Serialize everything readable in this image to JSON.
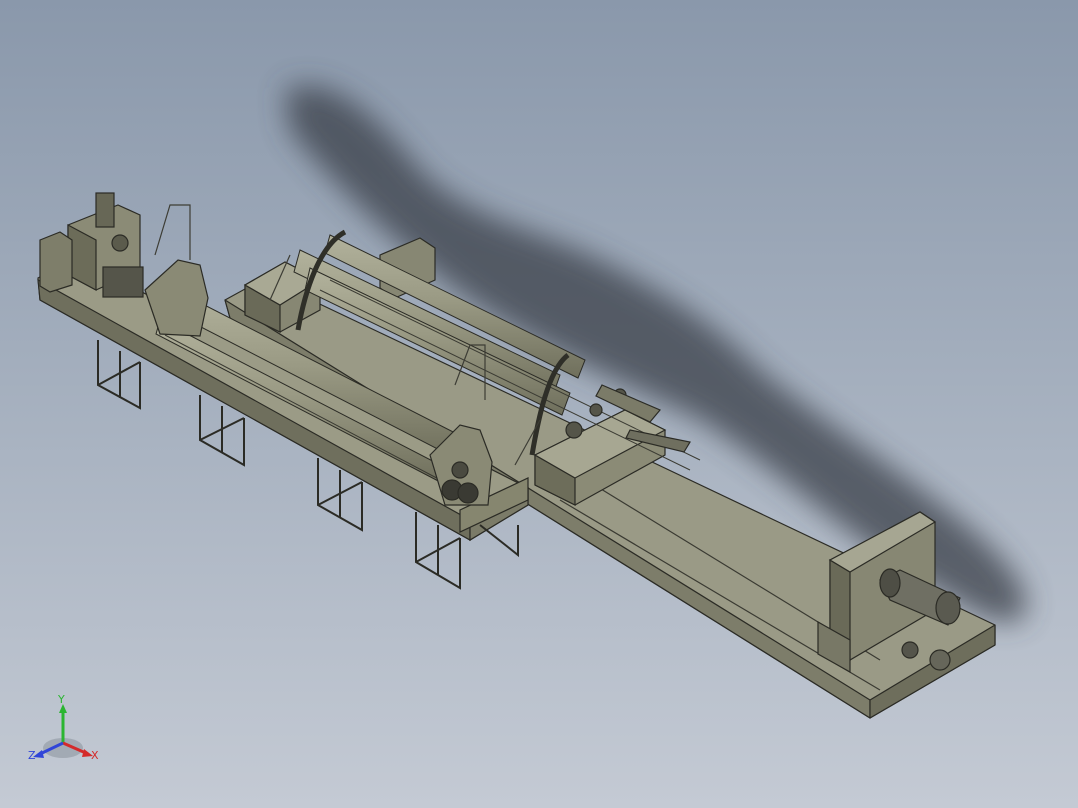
{
  "viewport": {
    "background_top": "#8a98ab",
    "background_bottom": "#c4cad4",
    "model_fill": "#8e8e79",
    "model_edge": "#2b2b25",
    "shadow_color": "#3a3f4a"
  },
  "triad": {
    "x_label": "X",
    "y_label": "Y",
    "z_label": "Z",
    "x_color": "#d42a2a",
    "y_color": "#2bb531",
    "z_color": "#3146d8"
  }
}
